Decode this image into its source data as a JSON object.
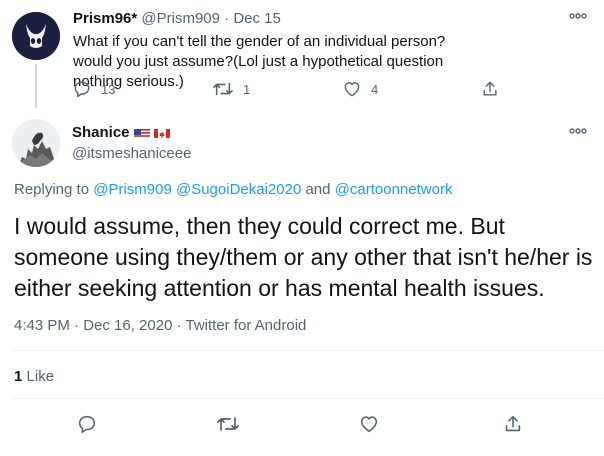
{
  "parent_tweet": {
    "display_name": "Prism96*",
    "handle": "@Prism909",
    "separator": "·",
    "date": "Dec 15",
    "text": "What if you can't tell the gender of an individual person? would you just assume?(Lol just a hypothetical question nothing serious.)",
    "reply_count": "13",
    "retweet_count": "1",
    "like_count": "4"
  },
  "main_tweet": {
    "display_name": "Shanice",
    "handle": "@itsmeshaniceee",
    "replying_to_label": "Replying to",
    "mention_1": "@Prism909",
    "mention_2": "@SugoiDekai2020",
    "and_label": "and",
    "mention_3": "@cartoonnetwork",
    "text": "I would assume, then they could correct me. But someone using they/them or any other that isn't he/her is either seeking attention or has mental health issues.",
    "timestamp": "4:43 PM · Dec 16, 2020 · Twitter for Android",
    "likes_count": "1",
    "likes_label": "Like"
  },
  "colors": {
    "link": "#1d9bf0",
    "secondary_text": "#536471",
    "primary_text": "#0f1419",
    "divider": "#eff3f4"
  },
  "icons": [
    "more-icon",
    "reply-icon",
    "retweet-icon",
    "like-icon",
    "share-icon",
    "us-flag-icon",
    "canada-flag-icon"
  ]
}
